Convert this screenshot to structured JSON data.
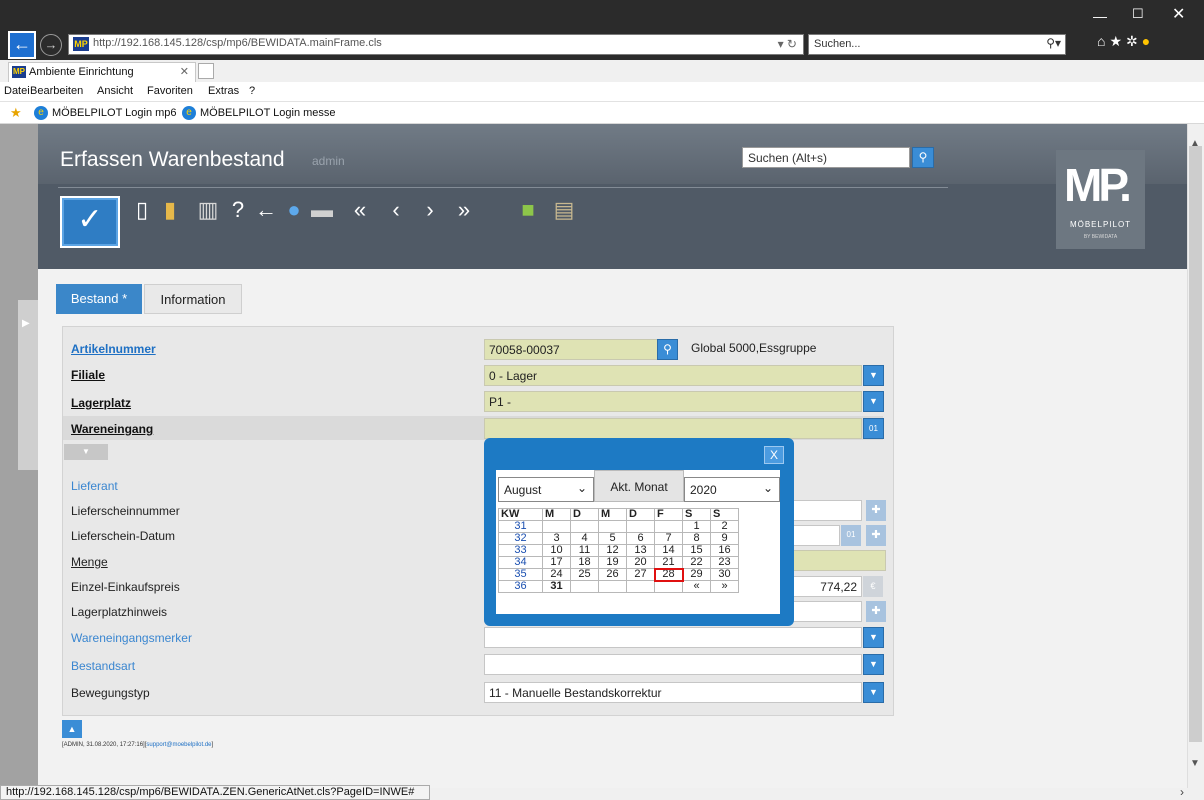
{
  "browser": {
    "url": "http://192.168.145.128/csp/mp6/BEWIDATA.mainFrame.cls",
    "search_placeholder": "Suchen...",
    "tab_title": "Ambiente Einrichtung",
    "menu": [
      "Datei",
      "Bearbeiten",
      "Ansicht",
      "Favoriten",
      "Extras",
      "?"
    ],
    "favorites": [
      "MÖBELPILOT Login mp6",
      "MÖBELPILOT Login messe"
    ],
    "status_url": "http://192.168.145.128/csp/mp6/BEWIDATA.ZEN.GenericAtNet.cls?PageID=INWE#"
  },
  "header": {
    "title": "Erfassen Warenbestand",
    "user": "admin",
    "search_placeholder": "Suchen (Alt+s)",
    "logo_letters": "MP.",
    "logo_name": "MÖBELPILOT",
    "logo_sub": "BY BEWIDATA"
  },
  "tabs": {
    "bestand": "Bestand *",
    "information": "Information"
  },
  "form": {
    "artikelnummer_label": "Artikelnummer",
    "artikelnummer_value": "70058-00037",
    "artikel_desc": "Global 5000,Essgruppe",
    "filiale_label": "Filiale",
    "filiale_value": "0 - Lager",
    "lagerplatz_label": "Lagerplatz",
    "lagerplatz_value": "P1 -",
    "wareneingang_label": "Wareneingang",
    "lieferant_label": "Lieferant",
    "lieferscheinnummer_label": "Lieferscheinnummer",
    "lieferschein_datum_label": "Lieferschein-Datum",
    "menge_label": "Menge",
    "einzel_einkaufspreis_label": "Einzel-Einkaufspreis",
    "einzel_einkaufspreis_value": "774,22",
    "lagerplatzhinweis_label": "Lagerplatzhinweis",
    "wareneingangsmerker_label": "Wareneingangsmerker",
    "bestandsart_label": "Bestandsart",
    "bewegungstyp_label": "Bewegungstyp",
    "bewegungstyp_value": "11 - Manuelle Bestandskorrektur"
  },
  "calendar": {
    "month": "August",
    "year": "2020",
    "today_button": "Akt. Monat",
    "close": "X",
    "headers": [
      "KW",
      "M",
      "D",
      "M",
      "D",
      "F",
      "S",
      "S"
    ],
    "weeks": [
      [
        "31",
        "",
        "",
        "",
        "",
        "",
        "1",
        "2"
      ],
      [
        "32",
        "3",
        "4",
        "5",
        "6",
        "7",
        "8",
        "9"
      ],
      [
        "33",
        "10",
        "11",
        "12",
        "13",
        "14",
        "15",
        "16"
      ],
      [
        "34",
        "17",
        "18",
        "19",
        "20",
        "21",
        "22",
        "23"
      ],
      [
        "35",
        "24",
        "25",
        "26",
        "27",
        "28",
        "29",
        "30"
      ],
      [
        "36",
        "31",
        "",
        "",
        "",
        "",
        "«",
        "»"
      ]
    ],
    "highlighted_day": "28",
    "today_day": "31"
  },
  "footer": {
    "info": "[ADMIN, 31.08.2020, 17:27:16][",
    "email": "support@moebelpilot.de",
    "info_end": "]"
  }
}
